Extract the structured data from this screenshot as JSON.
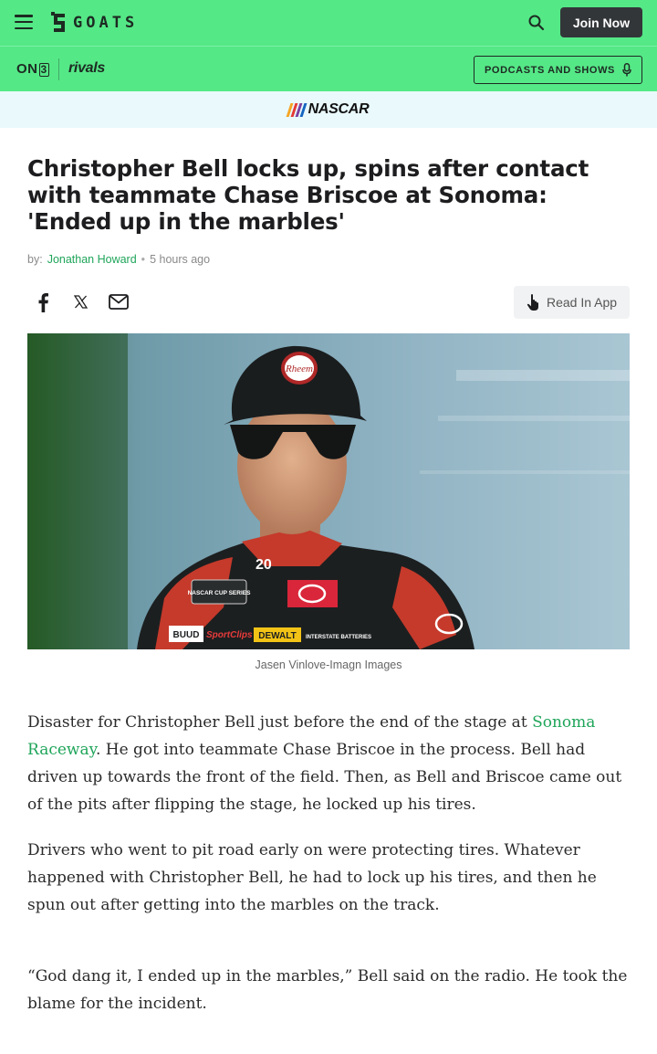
{
  "header": {
    "logo_text": "GOATS",
    "join_label": "Join Now"
  },
  "subnav": {
    "on3_prefix": "ON",
    "on3_suffix": "3",
    "rivals_label": "rivals",
    "podcasts_label": "PODCASTS AND SHOWS"
  },
  "category": {
    "label": "NASCAR",
    "stripe_colors": [
      "#f5a623",
      "#e53935",
      "#7b3fa0",
      "#1565c0"
    ]
  },
  "article": {
    "title": "Christopher Bell locks up, spins after contact with teammate Chase Briscoe at Sonoma: 'Ended up in the marbles'",
    "by_label": "by:",
    "author": "Jonathan Howard",
    "separator": "•",
    "time_ago": "5 hours ago",
    "read_in_app_label": "Read In App",
    "image_caption": "Jasen Vinlove-Imagn Images",
    "image_text": {
      "cap_logo": "Rheem",
      "car_number": "20",
      "patch": "NASCAR CUP SERIES",
      "sponsor_1": "BUUD",
      "sponsor_2": "SportClips",
      "sponsor_3": "DEWALT",
      "sponsor_4": "INTERSTATE BATTERIES"
    },
    "paragraph_1_before": "Disaster for Christopher Bell just before the end of the stage at ",
    "paragraph_1_link": "Sonoma Raceway",
    "paragraph_1_after": ". He got into teammate Chase Briscoe in the process. Bell had driven up towards the front of the field. Then, as Bell and Briscoe came out of the pits after flipping the stage, he locked up his tires.",
    "paragraph_2": "Drivers who went to pit road early on were protecting tires. Whatever happened with Christopher Bell, he had to lock up his tires, and then he spun out after getting into the marbles on the track.",
    "paragraph_3": "“God dang it, I ended up in the marbles,” Bell said on the radio. He took the blame for the incident."
  },
  "colors": {
    "brand_green": "#55e887",
    "link_green": "#1fa55a",
    "dark_button": "#333639"
  },
  "icons": [
    "menu-icon",
    "goats-logo-icon",
    "search-icon",
    "microphone-icon",
    "facebook-icon",
    "x-icon",
    "mail-icon",
    "tap-hand-icon"
  ]
}
